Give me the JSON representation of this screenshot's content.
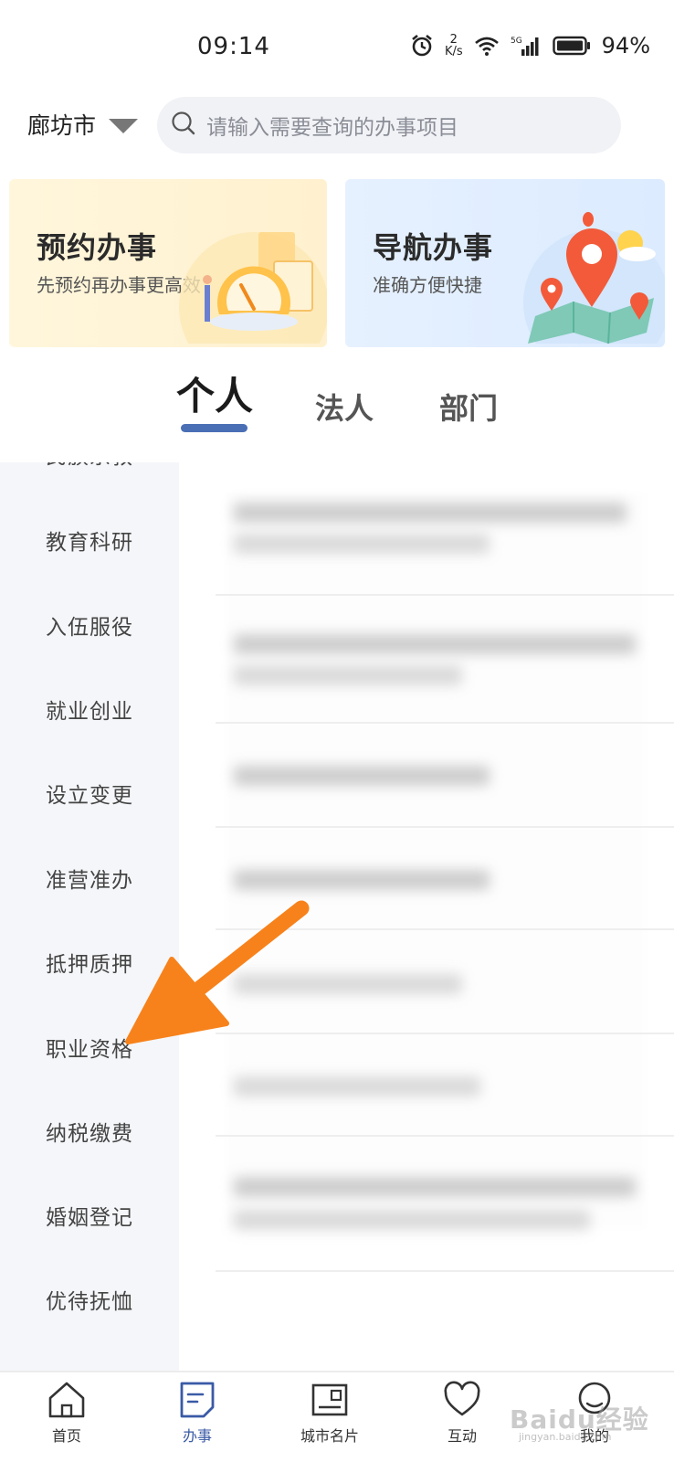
{
  "status": {
    "time": "09:14",
    "net_speed_value": "2",
    "net_speed_unit": "K/s",
    "network": "5G",
    "battery": "94%"
  },
  "header": {
    "city": "廊坊市",
    "search_placeholder": "请输入需要查询的办事项目"
  },
  "banners": [
    {
      "title": "预约办事",
      "subtitle": "先预约再办事更高效"
    },
    {
      "title": "导航办事",
      "subtitle": "准确方便快捷"
    }
  ],
  "tabs": [
    {
      "label": "个人",
      "active": true
    },
    {
      "label": "法人",
      "active": false
    },
    {
      "label": "部门",
      "active": false
    }
  ],
  "sidebar": {
    "items": [
      {
        "label": "民族宗教"
      },
      {
        "label": "教育科研"
      },
      {
        "label": "入伍服役"
      },
      {
        "label": "就业创业"
      },
      {
        "label": "设立变更"
      },
      {
        "label": "准营准办"
      },
      {
        "label": "抵押质押"
      },
      {
        "label": "职业资格"
      },
      {
        "label": "纳税缴费"
      },
      {
        "label": "婚姻登记"
      },
      {
        "label": "优待抚恤"
      }
    ]
  },
  "bottom_nav": {
    "items": [
      {
        "label": "首页",
        "icon": "home-icon"
      },
      {
        "label": "办事",
        "icon": "document-icon",
        "active": true
      },
      {
        "label": "城市名片",
        "icon": "postcard-icon"
      },
      {
        "label": "互动",
        "icon": "heart-icon"
      },
      {
        "label": "我的",
        "icon": "user-icon"
      }
    ]
  },
  "watermark": {
    "text": "Baidu经验",
    "sub": "jingyan.baidu.com"
  },
  "colors": {
    "accent": "#4a6fb5",
    "arrow": "#f7821b",
    "sidebar_bg": "#f5f6f9"
  }
}
